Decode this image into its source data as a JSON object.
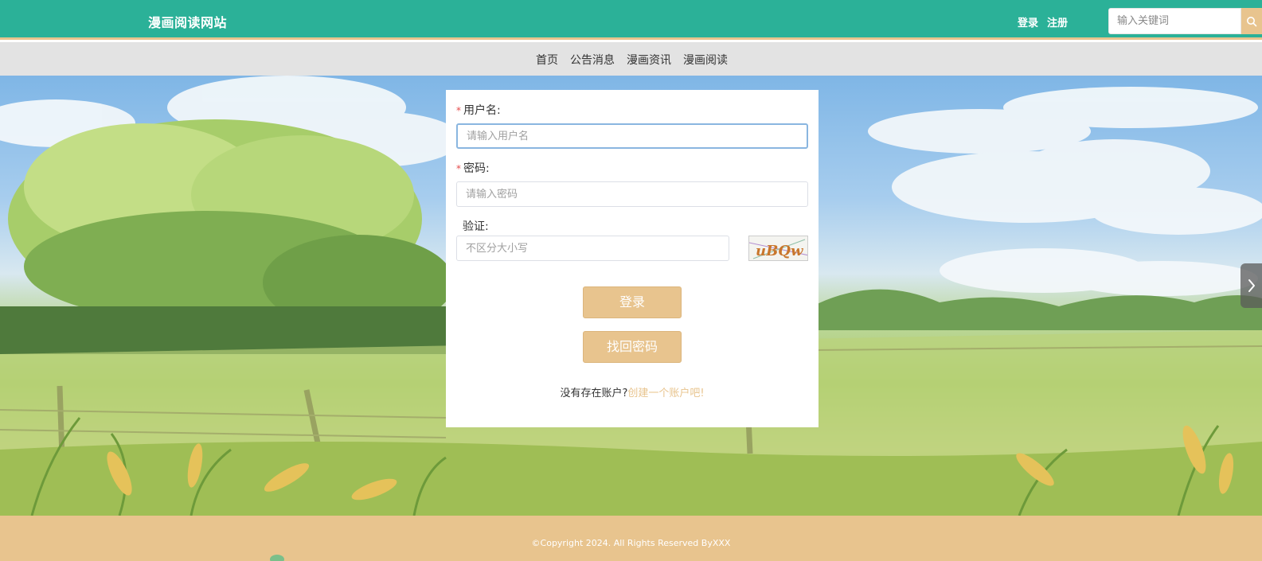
{
  "header": {
    "site_title": "漫画阅读网站",
    "login_label": "登录",
    "register_label": "注册",
    "search_placeholder": "输入关键词"
  },
  "nav": {
    "items": [
      "首页",
      "公告消息",
      "漫画资讯",
      "漫画阅读"
    ]
  },
  "login_form": {
    "username_label": "用户名:",
    "username_placeholder": "请输入用户名",
    "password_label": "密码:",
    "password_placeholder": "请输入密码",
    "captcha_label": "验证:",
    "captcha_placeholder": "不区分大小写",
    "captcha_text": "uBQw",
    "login_button": "登录",
    "recover_button": "找回密码",
    "no_account_text": "没有存在账户?",
    "create_account_link": "创建一个账户吧!"
  },
  "footer": {
    "copyright": "©Copyright 2024. All Rights Reserved ByXXX"
  },
  "colors": {
    "header_bg": "#2bb198",
    "accent": "#e8c48e",
    "nav_bg": "#e3e3e3"
  },
  "icons": {
    "search": "search-icon",
    "next": "chevron-right-icon"
  }
}
